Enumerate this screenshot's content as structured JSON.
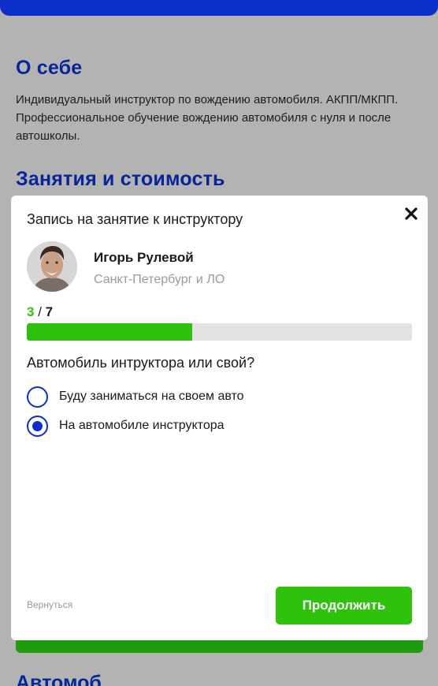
{
  "page": {
    "about_title": "О себе",
    "about_text": "Индивидуальный инструктор по вождению автомобиля. АКПП/МКПП. Профессиональное обучение вождению автомобиля с нуля и после автошколы.",
    "price_title": "Занятия и стоимость",
    "bottom_title": "Автомоб"
  },
  "modal": {
    "title": "Запись на занятие к инструктору",
    "instructor": {
      "name": "Игорь Рулевой",
      "city": "Санкт-Петербург и ЛО"
    },
    "step": {
      "current": "3",
      "separator": " / ",
      "total": "7",
      "progress_fraction": 0.43
    },
    "question": "Автомобиль интруктора или свой?",
    "options": [
      {
        "label": "Буду заниматься на своем авто",
        "selected": false
      },
      {
        "label": "На автомобиле инструктора",
        "selected": true
      }
    ],
    "back_label": "Вернуться",
    "continue_label": "Продолжить"
  },
  "colors": {
    "brand_blue": "#0b2fc7",
    "accent_green": "#2ec20d",
    "overlay": "#b3b3b3"
  },
  "icons": [
    "close-icon",
    "avatar-photo"
  ]
}
